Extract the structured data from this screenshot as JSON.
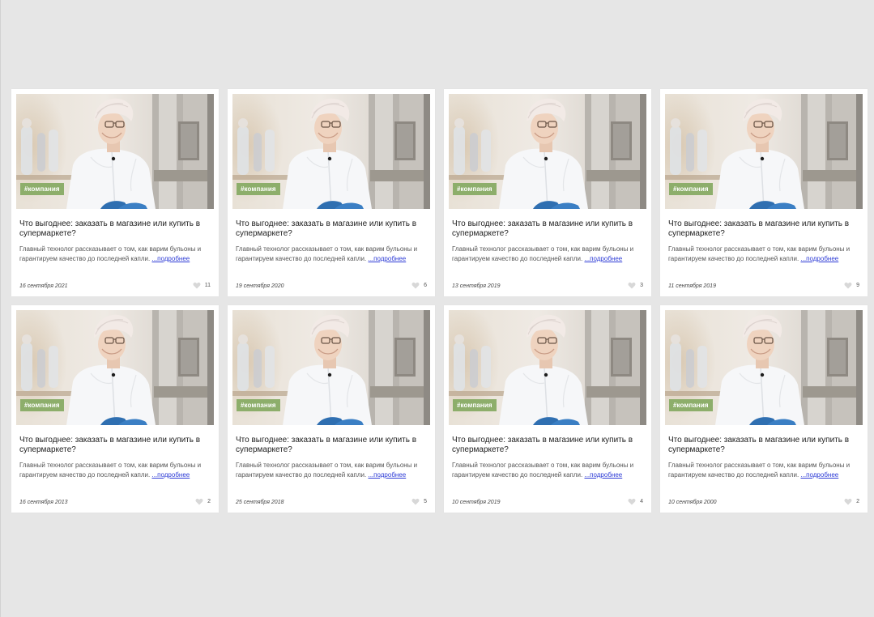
{
  "colors": {
    "background": "#e6e6e6",
    "card": "#ffffff",
    "tag": "#8dae6b",
    "link": "#2d3bd6",
    "heart": "#d8d8d8"
  },
  "cards": [
    {
      "tag": "#компания",
      "title": "Что выгоднее: заказать в магазине или купить в супермаркете?",
      "excerpt": "Главный технолог рассказывает о том, как варим бульоны и гарантируем качество до последней капли.",
      "more": "...подробнее",
      "date": "16 сентября 2021",
      "likes": "11",
      "image_icon": "photo-technologist"
    },
    {
      "tag": "#компания",
      "title": "Что выгоднее: заказать в магазине или купить в супермаркете?",
      "excerpt": "Главный технолог рассказывает о том, как варим бульоны и гарантируем качество до последней капли.",
      "more": "...подробнее",
      "date": "19 сентября 2020",
      "likes": "6",
      "image_icon": "photo-technologist"
    },
    {
      "tag": "#компания",
      "title": "Что выгоднее: заказать в магазине или купить в супермаркете?",
      "excerpt": "Главный технолог рассказывает о том, как варим бульоны и гарантируем качество до последней капли.",
      "more": "...подробнее",
      "date": "13 сентября 2019",
      "likes": "3",
      "image_icon": "photo-technologist"
    },
    {
      "tag": "#компания",
      "title": "Что выгоднее: заказать в магазине или купить в супермаркете?",
      "excerpt": "Главный технолог рассказывает о том, как варим бульоны и гарантируем качество до последней капли.",
      "more": "...подробнее",
      "date": "11 сентября 2019",
      "likes": "9",
      "image_icon": "photo-technologist"
    },
    {
      "tag": "#компания",
      "title": "Что выгоднее: заказать в магазине или купить в супермаркете?",
      "excerpt": "Главный технолог рассказывает о том, как варим бульоны и гарантируем качество до последней капли.",
      "more": "...подробнее",
      "date": "16 сентября 2013",
      "likes": "2",
      "image_icon": "photo-technologist"
    },
    {
      "tag": "#компания",
      "title": "Что выгоднее: заказать в магазине или купить в супермаркете?",
      "excerpt": "Главный технолог рассказывает о том, как варим бульоны и гарантируем качество до последней капли.",
      "more": "...подробнее",
      "date": "25 сентября 2018",
      "likes": "5",
      "image_icon": "photo-technologist"
    },
    {
      "tag": "#компания",
      "title": "Что выгоднее: заказать в магазине или купить в супермаркете?",
      "excerpt": "Главный технолог рассказывает о том, как варим бульоны и гарантируем качество до последней капли.",
      "more": "...подробнее",
      "date": "10 сентября 2019",
      "likes": "4",
      "image_icon": "photo-technologist"
    },
    {
      "tag": "#компания",
      "title": "Что выгоднее: заказать в магазине или купить в супермаркете?",
      "excerpt": "Главный технолог рассказывает о том, как варим бульоны и гарантируем качество до последней капли.",
      "more": "...подробнее",
      "date": "10 сентября 2000",
      "likes": "2",
      "image_icon": "photo-technologist"
    }
  ]
}
